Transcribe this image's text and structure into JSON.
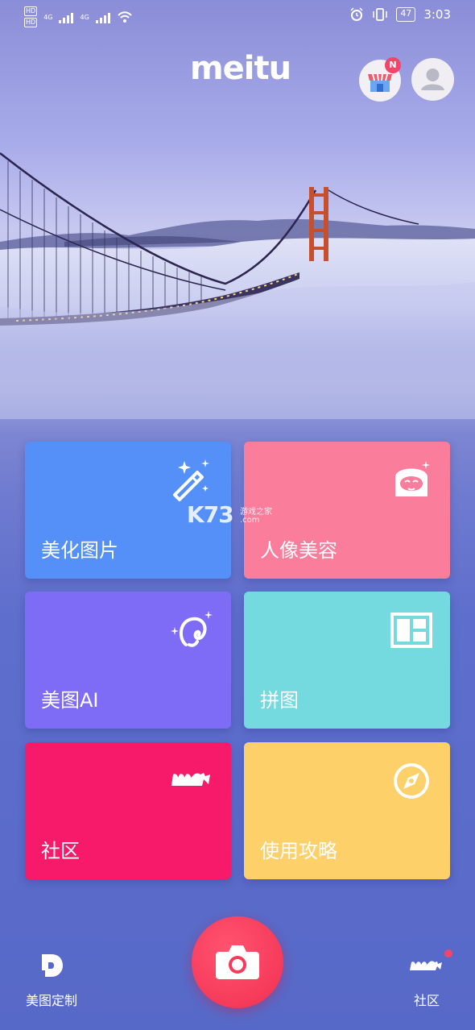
{
  "status_bar": {
    "network_left": "4G",
    "network_right": "4G",
    "battery": "47",
    "time": "3:03"
  },
  "header": {
    "logo": "meitu",
    "store_badge": "N"
  },
  "tiles": [
    {
      "label": "美化图片",
      "color": "#5490f7"
    },
    {
      "label": "人像美容",
      "color": "#fb7d9c"
    },
    {
      "label": "美图AI",
      "color": "#7e6cf7"
    },
    {
      "label": "拼图",
      "color": "#74dadf"
    },
    {
      "label": "社区",
      "color": "#f81a6a"
    },
    {
      "label": "使用攻略",
      "color": "#fdd06a"
    }
  ],
  "watermark": {
    "logo_text": "K73",
    "site_cn": "游戏之家",
    "site_domain": ".com"
  },
  "bottom_nav": {
    "left_label": "美图定制",
    "right_label": "社区"
  }
}
